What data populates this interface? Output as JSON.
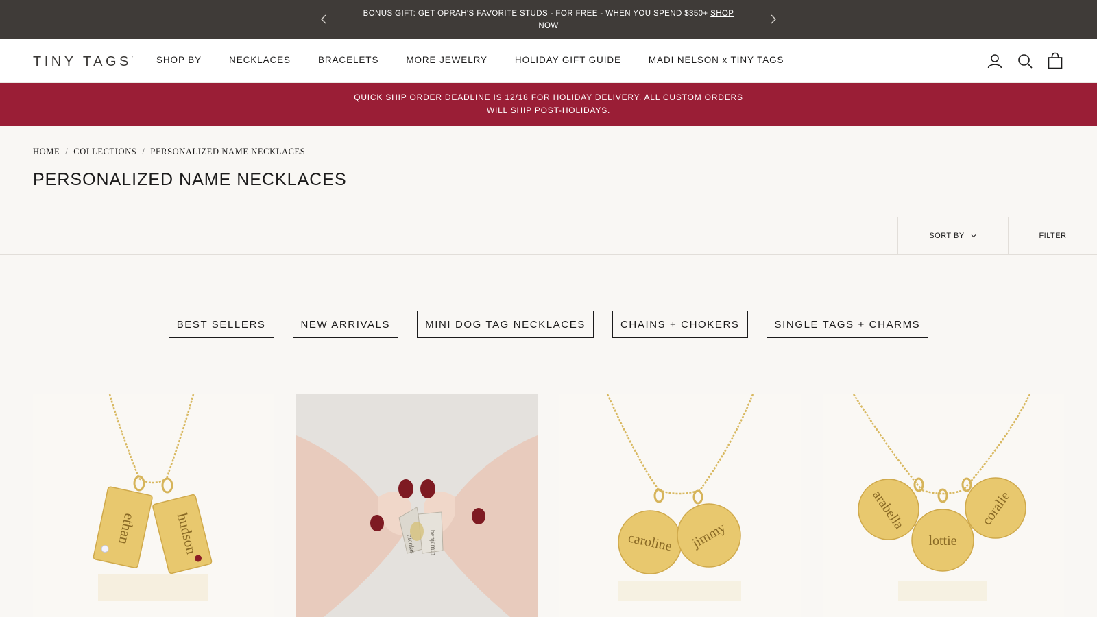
{
  "announcement": {
    "message": "BONUS GIFT: GET OPRAH'S FAVORITE STUDS - FOR FREE - WHEN YOU SPEND $350+",
    "link_label": "SHOP NOW",
    "prev_icon": "chevron-left-icon",
    "next_icon": "chevron-right-icon"
  },
  "header": {
    "logo": "TINY TAGS",
    "logo_mark": "'",
    "nav": [
      {
        "label": "SHOP BY"
      },
      {
        "label": "NECKLACES"
      },
      {
        "label": "BRACELETS"
      },
      {
        "label": "MORE JEWELRY"
      },
      {
        "label": "HOLIDAY GIFT GUIDE"
      },
      {
        "label": "MADI NELSON x TINY TAGS"
      }
    ],
    "icons": [
      "account-icon",
      "search-icon",
      "bag-icon"
    ]
  },
  "promo": {
    "text": "QUICK SHIP ORDER DEADLINE IS 12/18 FOR HOLIDAY DELIVERY. ALL CUSTOM ORDERS WILL SHIP POST-HOLIDAYS.",
    "color": "#9a1e36"
  },
  "breadcrumb": [
    {
      "label": "HOME"
    },
    {
      "label": "COLLECTIONS"
    },
    {
      "label": "PERSONALIZED NAME NECKLACES"
    }
  ],
  "page_title": "PERSONALIZED NAME NECKLACES",
  "toolbar": {
    "sort_label": "SORT BY",
    "filter_label": "FILTER"
  },
  "categories": [
    {
      "label": "BEST SELLERS"
    },
    {
      "label": "NEW ARRIVALS"
    },
    {
      "label": "MINI DOG TAG NECKLACES"
    },
    {
      "label": "CHAINS + CHOKERS"
    },
    {
      "label": "SINGLE TAGS + CHARMS"
    }
  ],
  "products": [
    {
      "image": "gold-dog-tag-necklace",
      "engravings": [
        "ethan",
        "hudson"
      ]
    },
    {
      "image": "hands-holding-charms",
      "engravings": [
        "nicolas",
        "benjamin"
      ]
    },
    {
      "image": "gold-disc-necklace",
      "engravings": [
        "caroline",
        "jimmy"
      ]
    },
    {
      "image": "gold-three-disc-necklace",
      "engravings": [
        "arabella",
        "lottie",
        "coralie"
      ]
    }
  ],
  "colors": {
    "announcement_bg": "#3f3b38",
    "page_bg": "#f9f7f4",
    "gold": "#e6c56e",
    "accent": "#9a1e36"
  }
}
